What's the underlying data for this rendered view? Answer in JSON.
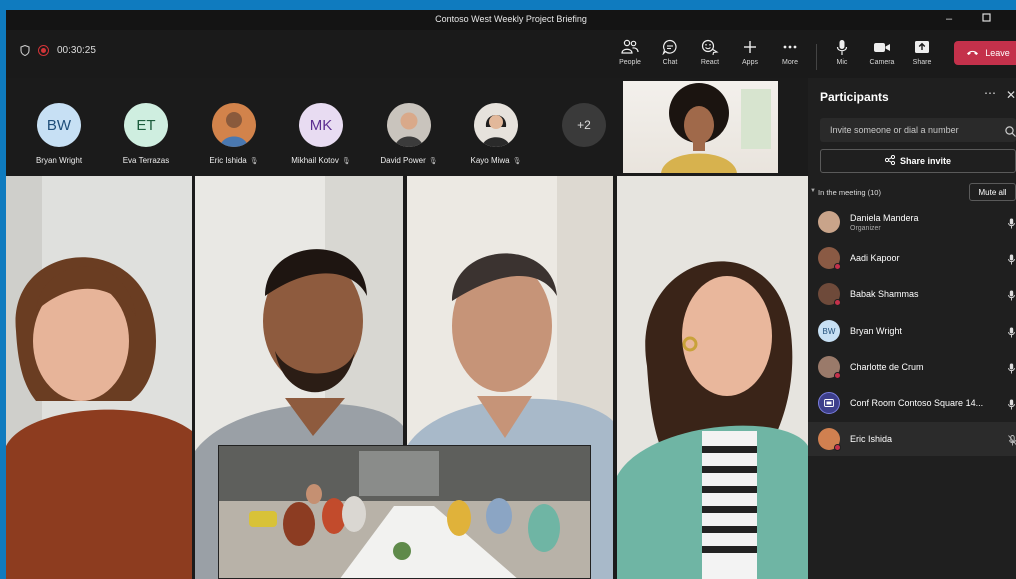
{
  "window": {
    "title": "Contoso West Weekly Project Briefing",
    "minimize_icon": "minimize-icon",
    "maximize_icon": "maximize-icon"
  },
  "toolbar": {
    "timer": "00:30:25",
    "buttons": [
      {
        "label": "People",
        "icon": "people-icon"
      },
      {
        "label": "Chat",
        "icon": "chat-icon"
      },
      {
        "label": "React",
        "icon": "react-icon"
      },
      {
        "label": "Apps",
        "icon": "plus-icon"
      },
      {
        "label": "More",
        "icon": "more-icon"
      },
      {
        "label": "Mic",
        "icon": "mic-icon"
      },
      {
        "label": "Camera",
        "icon": "camera-icon"
      },
      {
        "label": "Share",
        "icon": "share-icon"
      }
    ],
    "leave_label": "Leave",
    "leave_color": "#c4314b"
  },
  "attendees": [
    {
      "initials": "BW",
      "name": "Bryan Wright",
      "color": "#c7e0f4"
    },
    {
      "initials": "ET",
      "name": "Eva Terrazas",
      "color": "#cfeee0"
    },
    {
      "initials": "",
      "name": "Eric Ishida",
      "muted": true,
      "color": "#d08050"
    },
    {
      "initials": "MK",
      "name": "Mikhail Kotov",
      "muted": true,
      "color": "#e8dcf2"
    },
    {
      "initials": "",
      "name": "David Power",
      "muted": true,
      "color": "#b7b1aa"
    },
    {
      "initials": "",
      "name": "Kayo Miwa",
      "muted": true,
      "color": "#d8d4cf"
    }
  ],
  "overflow_count": "+2",
  "panel": {
    "title": "Participants",
    "invite_placeholder": "Invite someone or dial a number",
    "share_invite_label": "Share invite",
    "section_label": "In the meeting (10)",
    "mute_all_label": "Mute all",
    "participants": [
      {
        "name": "Daniela Mandera",
        "role": "Organizer",
        "color": "#c9a48a"
      },
      {
        "name": "Aadi Kapoor",
        "color": "#8a5a44"
      },
      {
        "name": "Babak Shammas",
        "color": "#6e4a3a"
      },
      {
        "name": "Bryan Wright",
        "initials": "BW",
        "color": "#c7e0f4"
      },
      {
        "name": "Charlotte de Crum",
        "color": "#9a7a6a"
      },
      {
        "name": "Conf Room Contoso Square 14...",
        "color": "#5b5fc7"
      },
      {
        "name": "Eric Ishida",
        "color": "#d08050",
        "muted": true
      }
    ]
  }
}
